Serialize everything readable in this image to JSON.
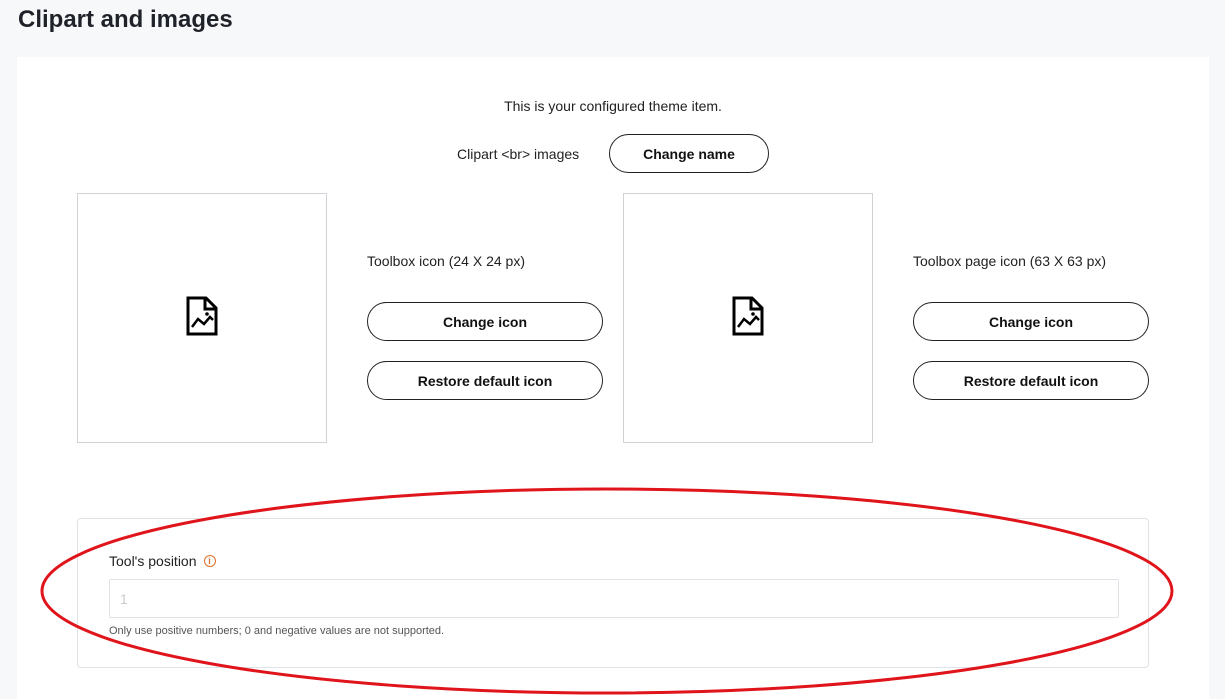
{
  "header": {
    "title": "Clipart and images"
  },
  "theme_item": {
    "configured_text": "This is your configured theme item.",
    "name_label": "Clipart <br> images",
    "change_name_label": "Change name"
  },
  "icons": [
    {
      "label": "Toolbox icon (24 X 24 px)",
      "preview_icon": "image-file-icon",
      "change_label": "Change icon",
      "restore_label": "Restore default icon"
    },
    {
      "label": "Toolbox page icon (63 X 63 px)",
      "preview_icon": "image-file-icon",
      "change_label": "Change icon",
      "restore_label": "Restore default icon"
    }
  ],
  "tool_position": {
    "label": "Tool's position",
    "info_icon": "info-icon",
    "placeholder": "1",
    "value": "",
    "hint": "Only use positive numbers; 0 and negative values are not supported."
  },
  "colors": {
    "annotation": "#e0141b",
    "info": "#e0702b"
  }
}
